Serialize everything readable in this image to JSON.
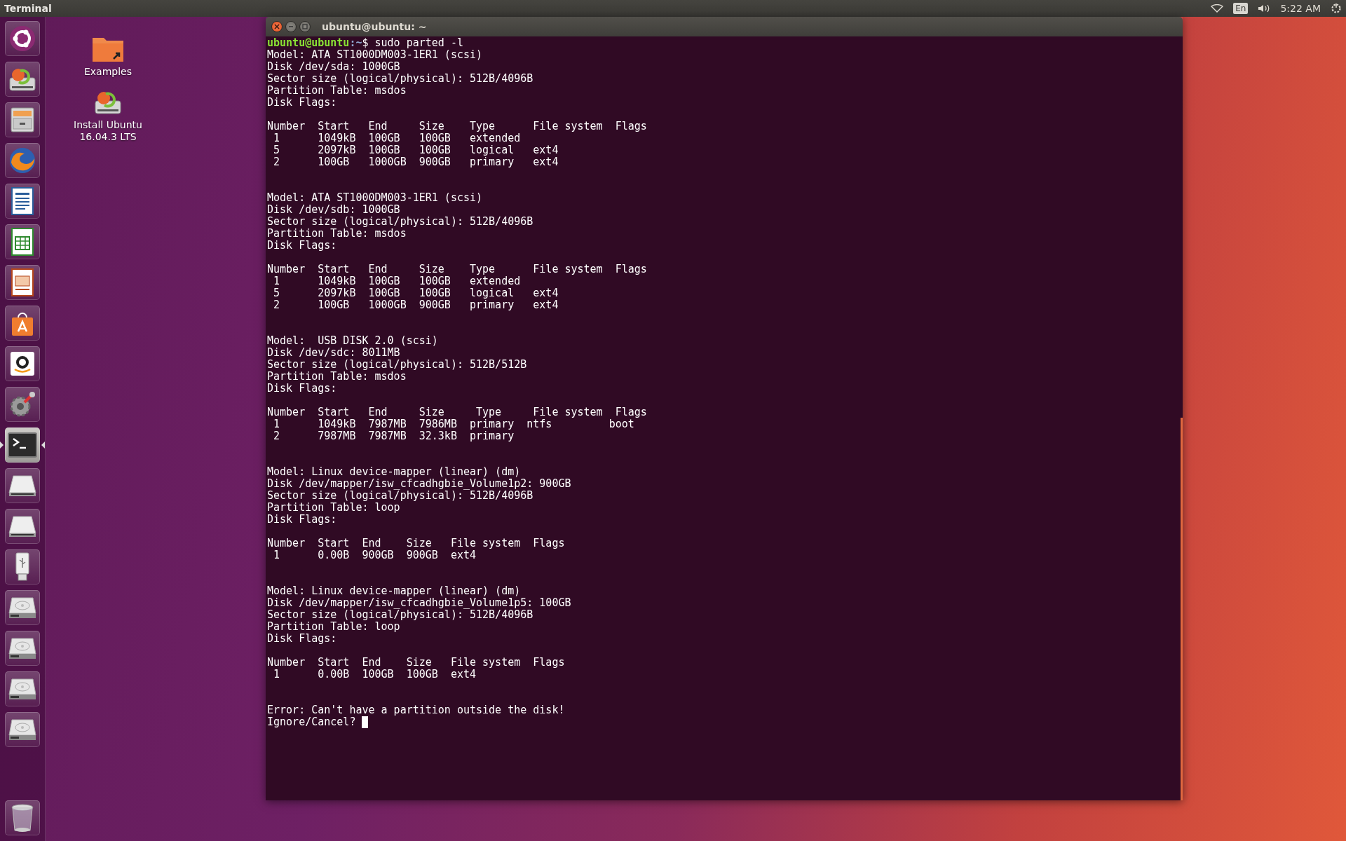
{
  "top_bar": {
    "app_title": "Terminal",
    "keyboard_layout": "En",
    "clock": "5:22 AM"
  },
  "launcher": [
    {
      "kind": "dash",
      "selected": false
    },
    {
      "kind": "installer",
      "selected": false
    },
    {
      "kind": "files",
      "selected": false
    },
    {
      "kind": "browser",
      "selected": false
    },
    {
      "kind": "writer",
      "selected": false
    },
    {
      "kind": "calc",
      "selected": false
    },
    {
      "kind": "impress",
      "selected": false
    },
    {
      "kind": "software",
      "selected": false
    },
    {
      "kind": "amazon",
      "selected": false
    },
    {
      "kind": "settings",
      "selected": false
    },
    {
      "kind": "terminal",
      "selected": true
    },
    {
      "kind": "removable",
      "selected": false
    },
    {
      "kind": "removable",
      "selected": false
    },
    {
      "kind": "usb",
      "selected": false
    },
    {
      "kind": "disk",
      "selected": false
    },
    {
      "kind": "disk",
      "selected": false
    },
    {
      "kind": "disk",
      "selected": false
    },
    {
      "kind": "disk",
      "selected": false
    },
    {
      "kind": "trash",
      "selected": false
    }
  ],
  "desktop_icons": [
    {
      "kind": "folder",
      "label": "Examples"
    },
    {
      "kind": "installer",
      "label": "Install Ubuntu 16.04.3 LTS"
    }
  ],
  "terminal": {
    "title": "ubuntu@ubuntu: ~",
    "prompt": {
      "user": "ubuntu@ubuntu",
      "path": ":~",
      "command": "$ sudo parted -l"
    },
    "disks": [
      {
        "header": [
          "Model: ATA ST1000DM003-1ER1 (scsi)",
          "Disk /dev/sda: 1000GB",
          "Sector size (logical/physical): 512B/4096B",
          "Partition Table: msdos",
          "Disk Flags:"
        ],
        "table": [
          "Number  Start   End     Size    Type      File system  Flags",
          " 1      1049kB  100GB   100GB   extended",
          " 5      2097kB  100GB   100GB   logical   ext4",
          " 2      100GB   1000GB  900GB   primary   ext4"
        ]
      },
      {
        "header": [
          "Model: ATA ST1000DM003-1ER1 (scsi)",
          "Disk /dev/sdb: 1000GB",
          "Sector size (logical/physical): 512B/4096B",
          "Partition Table: msdos",
          "Disk Flags:"
        ],
        "table": [
          "Number  Start   End     Size    Type      File system  Flags",
          " 1      1049kB  100GB   100GB   extended",
          " 5      2097kB  100GB   100GB   logical   ext4",
          " 2      100GB   1000GB  900GB   primary   ext4"
        ]
      },
      {
        "header": [
          "Model:  USB DISK 2.0 (scsi)",
          "Disk /dev/sdc: 8011MB",
          "Sector size (logical/physical): 512B/512B",
          "Partition Table: msdos",
          "Disk Flags:"
        ],
        "table": [
          "Number  Start   End     Size     Type     File system  Flags",
          " 1      1049kB  7987MB  7986MB  primary  ntfs         boot",
          " 2      7987MB  7987MB  32.3kB  primary"
        ]
      },
      {
        "header": [
          "Model: Linux device-mapper (linear) (dm)",
          "Disk /dev/mapper/isw_cfcadhgbie_Volume1p2: 900GB",
          "Sector size (logical/physical): 512B/4096B",
          "Partition Table: loop",
          "Disk Flags:"
        ],
        "table": [
          "Number  Start  End    Size   File system  Flags",
          " 1      0.00B  900GB  900GB  ext4"
        ]
      },
      {
        "header": [
          "Model: Linux device-mapper (linear) (dm)",
          "Disk /dev/mapper/isw_cfcadhgbie_Volume1p5: 100GB",
          "Sector size (logical/physical): 512B/4096B",
          "Partition Table: loop",
          "Disk Flags:"
        ],
        "table": [
          "Number  Start  End    Size   File system  Flags",
          " 1      0.00B  100GB  100GB  ext4"
        ]
      }
    ],
    "error": "Error: Can't have a partition outside the disk!",
    "input": {
      "text": "Ignore/Cancel? ",
      "cursor": true
    }
  }
}
